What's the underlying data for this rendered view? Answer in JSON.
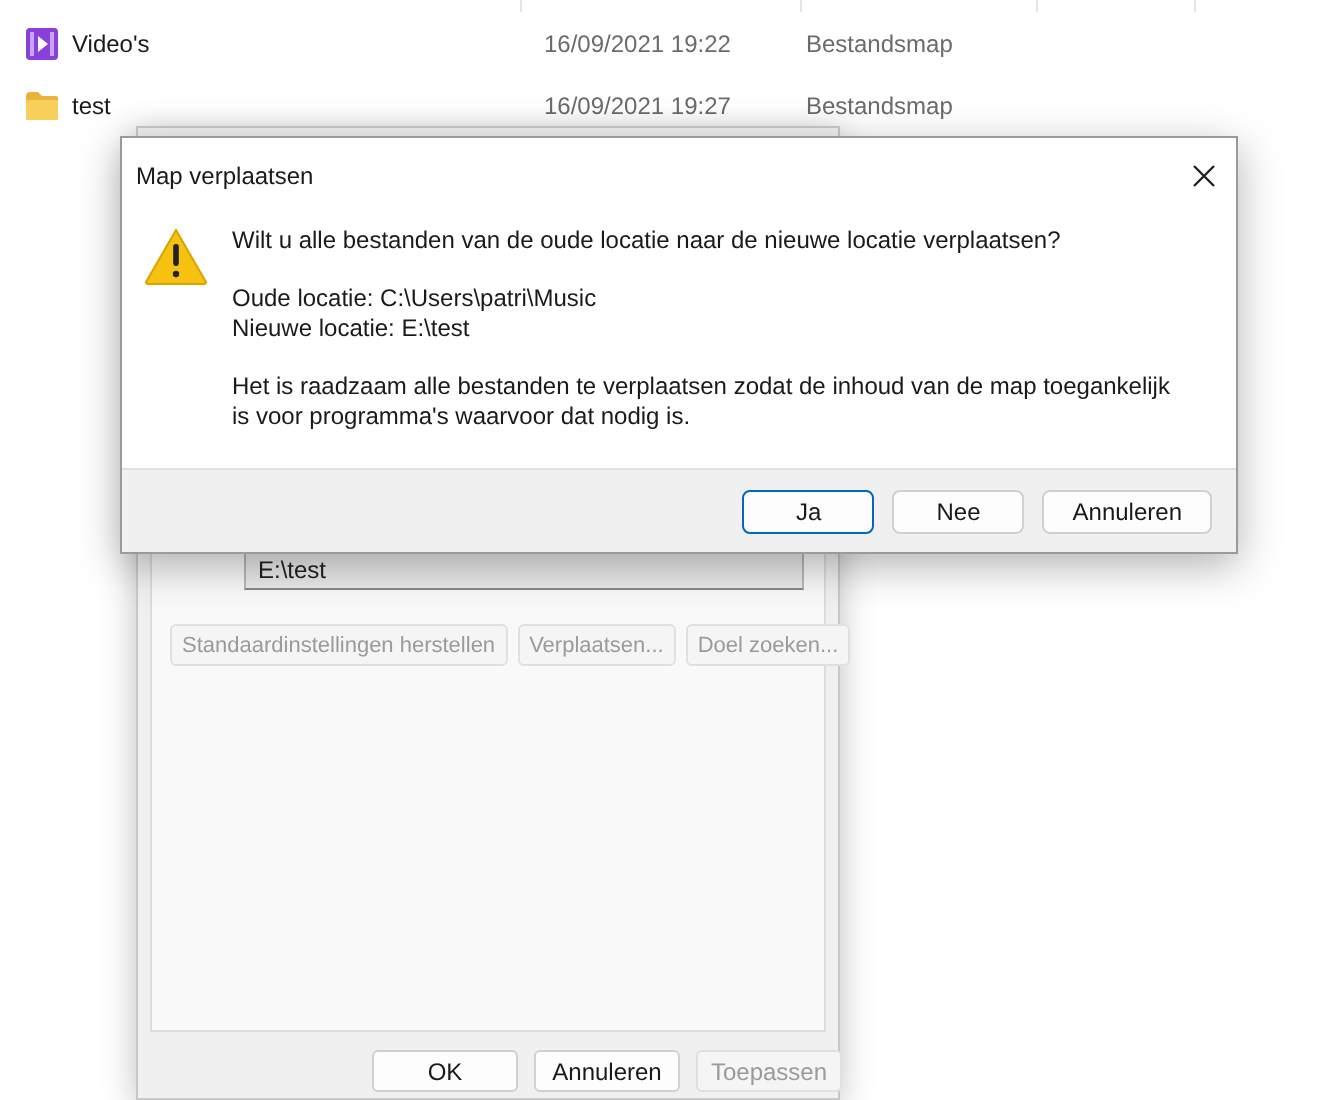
{
  "explorer": {
    "files": [
      {
        "kind": "video",
        "name": "Video's",
        "modified": "16/09/2021 19:22",
        "type": "Bestandsmap"
      },
      {
        "kind": "folder",
        "name": "test",
        "modified": "16/09/2021 19:27",
        "type": "Bestandsmap"
      }
    ]
  },
  "properties_window": {
    "path_field": "E:\\test",
    "buttons": [
      {
        "label": "Standaardinstellingen herstellen",
        "disabled": true
      },
      {
        "label": "Verplaatsen...",
        "disabled": true
      },
      {
        "label": "Doel zoeken...",
        "disabled": true
      }
    ],
    "footer_buttons": [
      {
        "label": "OK",
        "disabled": false
      },
      {
        "label": "Annuleren",
        "disabled": false
      },
      {
        "label": "Toepassen",
        "disabled": true
      }
    ]
  },
  "dialog": {
    "title": "Map verplaatsen",
    "question": "Wilt u alle bestanden van de oude locatie naar de nieuwe locatie verplaatsen?",
    "details": [
      "Oude locatie: C:\\Users\\patri\\Music",
      "Nieuwe locatie: E:\\test"
    ],
    "note": "Het is raadzaam alle bestanden te verplaatsen zodat de inhoud van de map toegankelijk is voor programma's waarvoor dat nodig is.",
    "buttons": [
      {
        "label": "Ja",
        "default": true
      },
      {
        "label": "Nee",
        "default": false
      },
      {
        "label": "Annuleren",
        "default": false
      }
    ]
  }
}
